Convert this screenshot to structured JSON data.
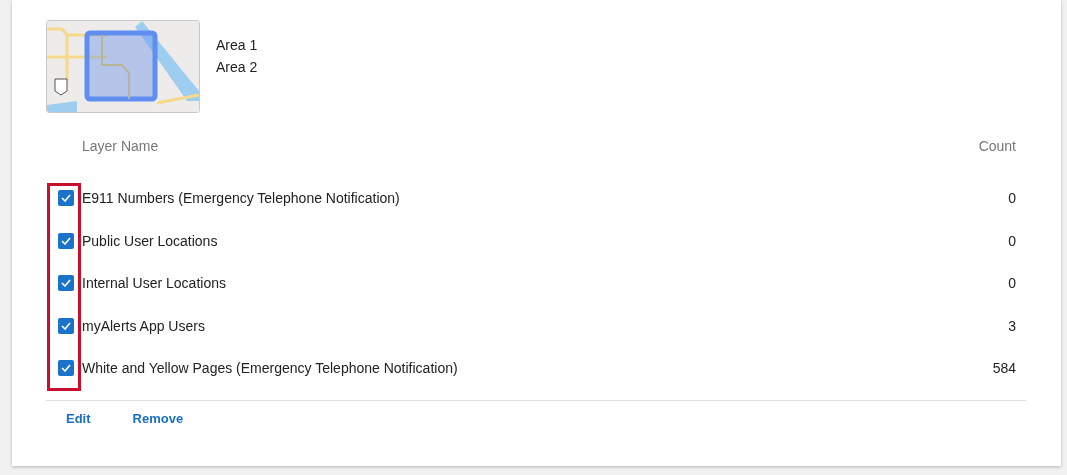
{
  "areas": [
    "Area 1",
    "Area 2"
  ],
  "table": {
    "columns": [
      "Layer Name",
      "Count"
    ],
    "rows": [
      {
        "name": "E911 Numbers (Emergency Telephone Notification)",
        "count": "0",
        "checked": true
      },
      {
        "name": "Public User Locations",
        "count": "0",
        "checked": true
      },
      {
        "name": "Internal User Locations",
        "count": "0",
        "checked": true
      },
      {
        "name": "myAlerts App Users",
        "count": "3",
        "checked": true
      },
      {
        "name": "White and Yellow Pages (Emergency Telephone Notification)",
        "count": "584",
        "checked": true
      }
    ]
  },
  "highlight": {
    "on": true
  },
  "actions": [
    "Edit",
    "Remove"
  ]
}
